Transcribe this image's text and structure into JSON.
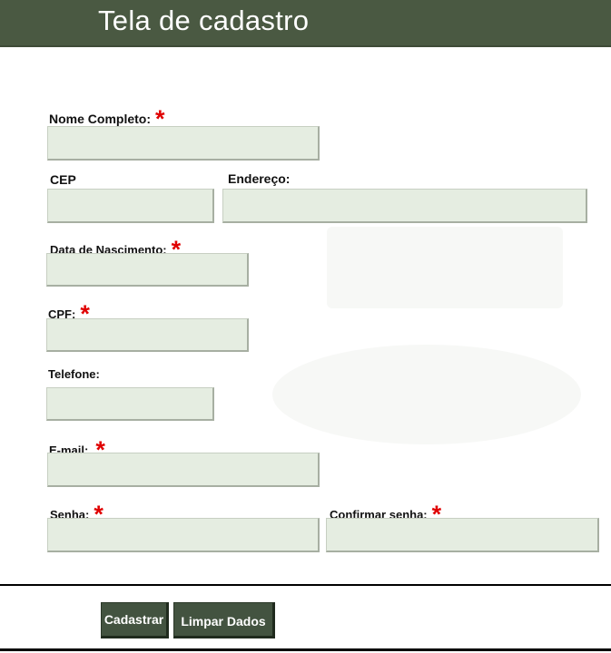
{
  "header": {
    "title": "Tela de cadastro"
  },
  "form": {
    "required_mark": "*",
    "nome": {
      "label": "Nome Completo:",
      "value": ""
    },
    "cep": {
      "label": "CEP",
      "value": ""
    },
    "endereco": {
      "label": "Endereço:",
      "value": ""
    },
    "nascimento": {
      "label": "Data de Nascimento:",
      "value": ""
    },
    "cpf": {
      "label": "CPF:",
      "value": ""
    },
    "telefone": {
      "label": "Telefone:",
      "value": ""
    },
    "email": {
      "label": "E-mail:",
      "value": ""
    },
    "senha": {
      "label": "Senha:",
      "value": ""
    },
    "confirmar": {
      "label": "Confirmar senha:",
      "value": ""
    }
  },
  "actions": {
    "submit_label": "Cadastrar",
    "clear_label": "Limpar Dados"
  },
  "colors": {
    "header_bg": "#4a5942",
    "field_bg": "#e5ede1",
    "required": "#e00000",
    "button_bg": "#435340"
  }
}
